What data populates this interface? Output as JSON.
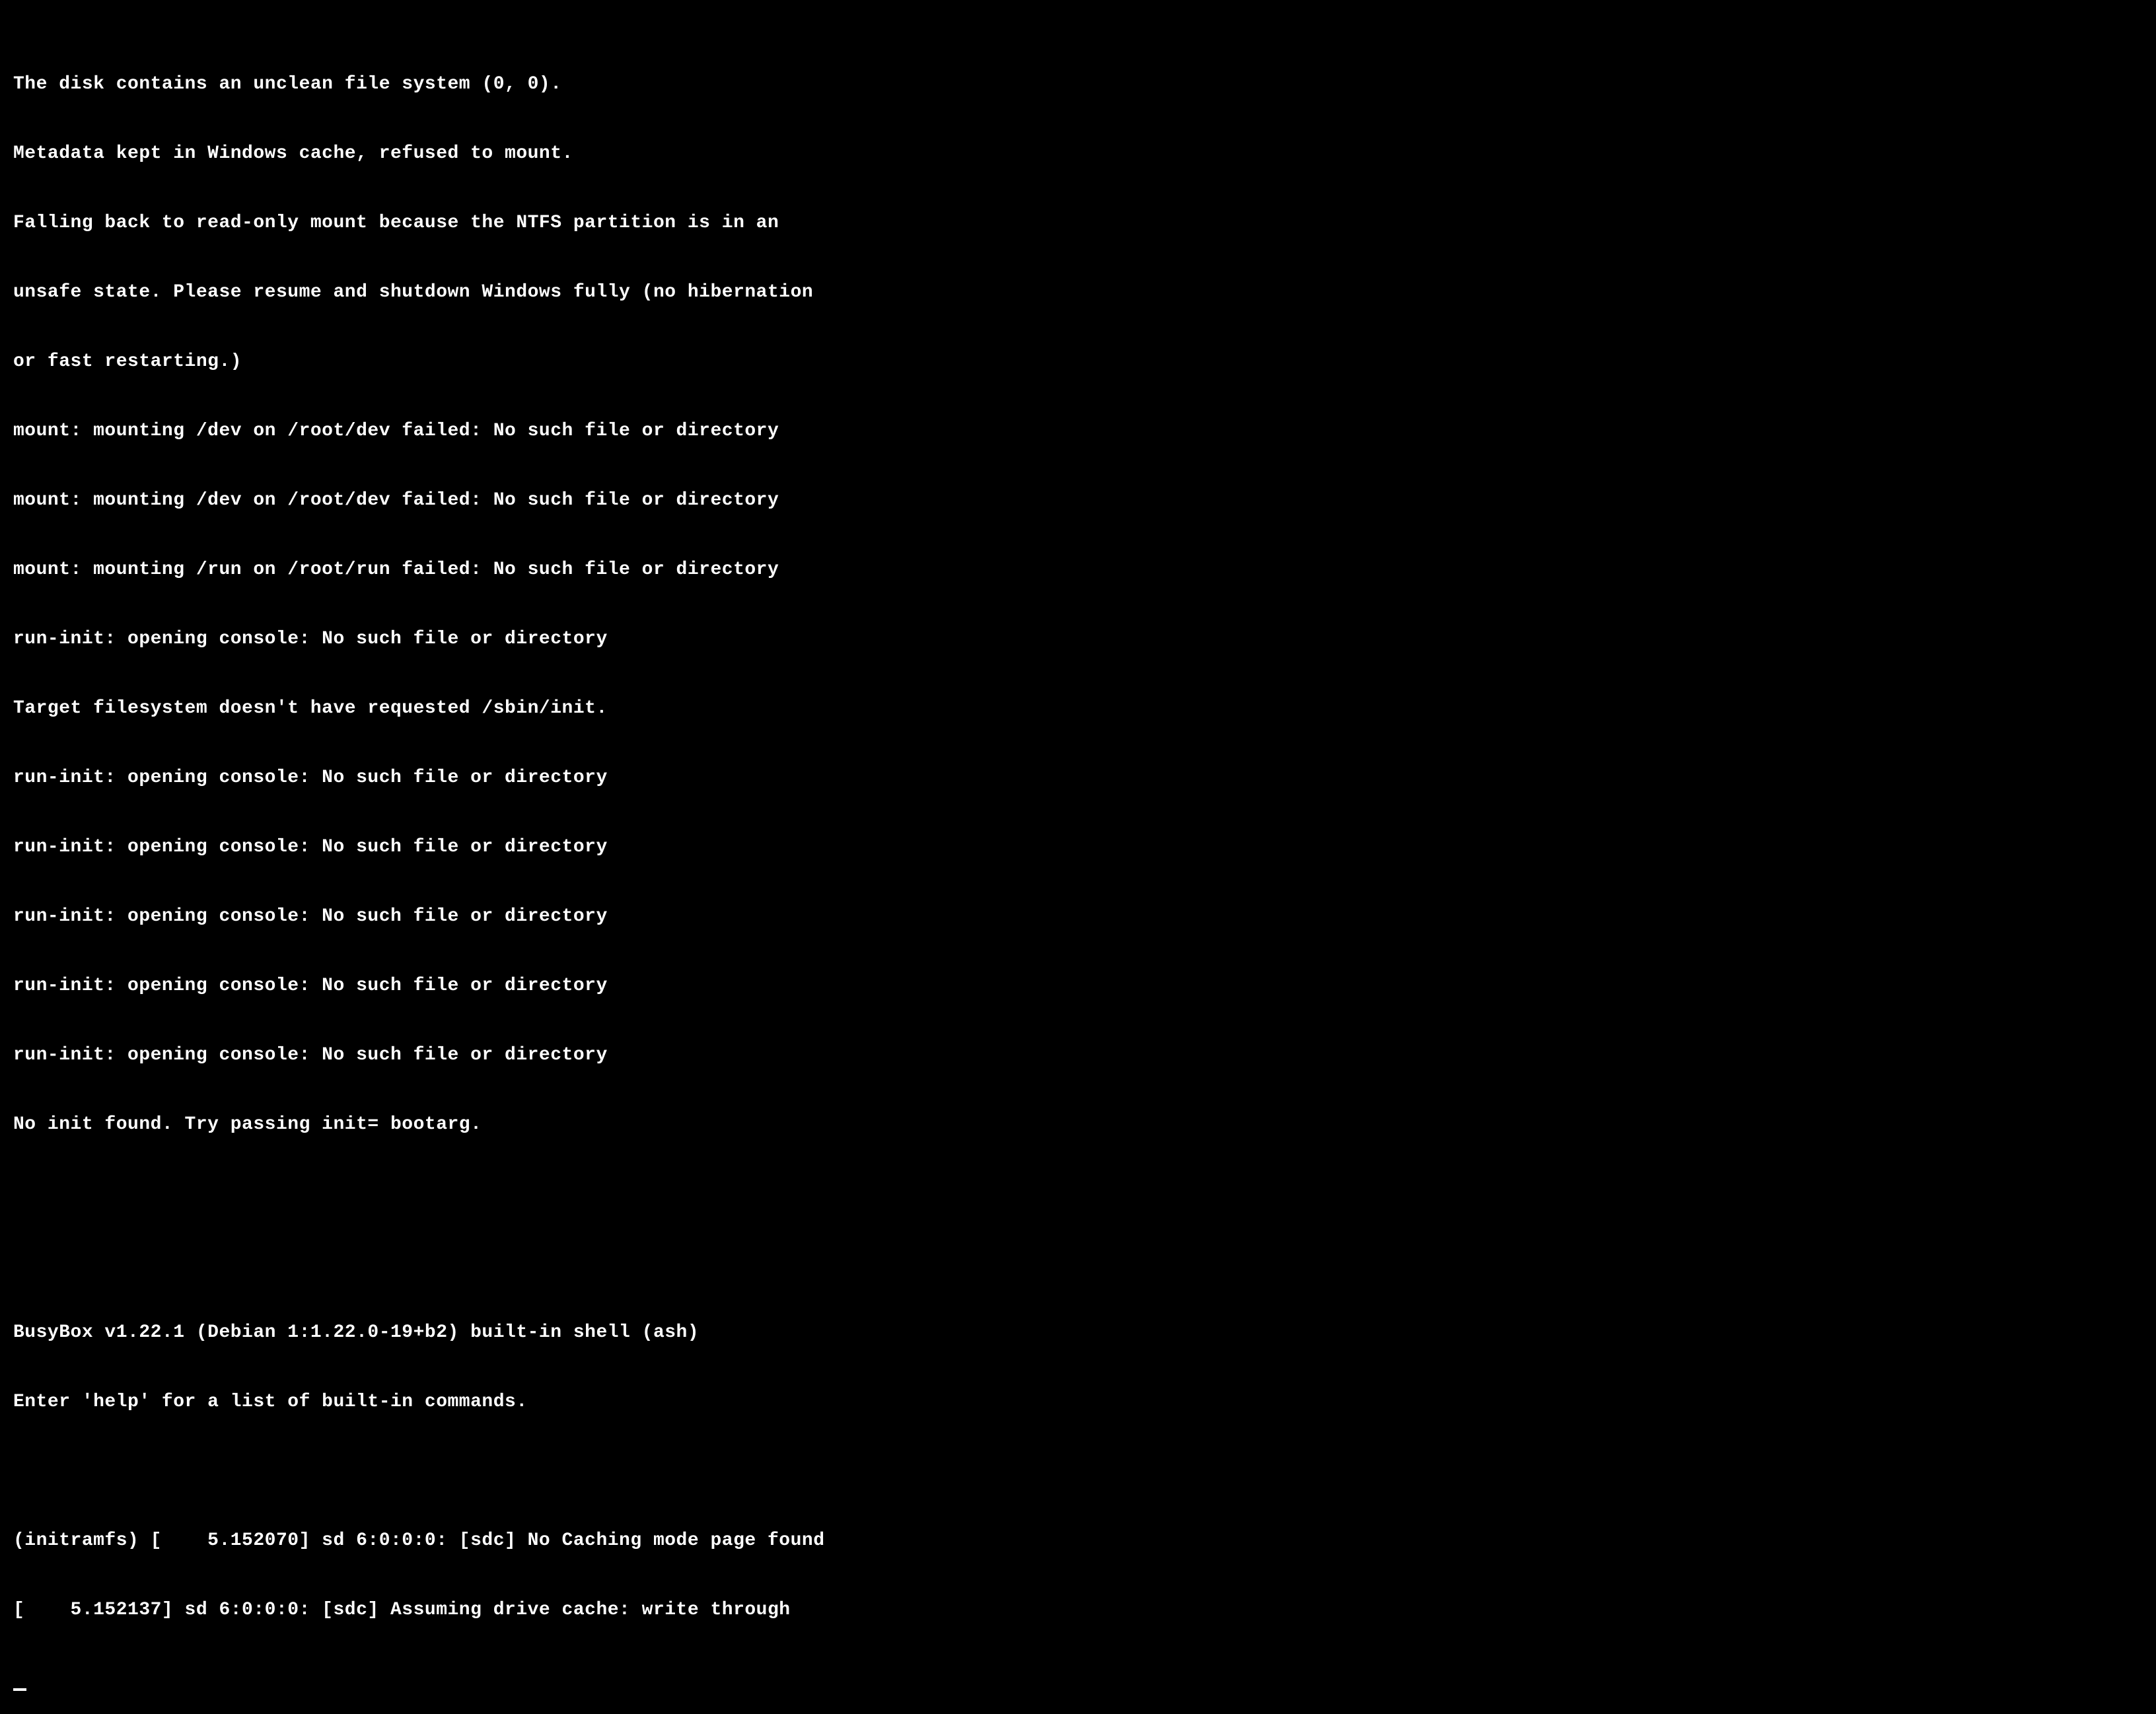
{
  "terminal": {
    "lines": [
      "The disk contains an unclean file system (0, 0).",
      "Metadata kept in Windows cache, refused to mount.",
      "Falling back to read-only mount because the NTFS partition is in an",
      "unsafe state. Please resume and shutdown Windows fully (no hibernation",
      "or fast restarting.)",
      "mount: mounting /dev on /root/dev failed: No such file or directory",
      "mount: mounting /dev on /root/dev failed: No such file or directory",
      "mount: mounting /run on /root/run failed: No such file or directory",
      "run-init: opening console: No such file or directory",
      "Target filesystem doesn't have requested /sbin/init.",
      "run-init: opening console: No such file or directory",
      "run-init: opening console: No such file or directory",
      "run-init: opening console: No such file or directory",
      "run-init: opening console: No such file or directory",
      "run-init: opening console: No such file or directory",
      "No init found. Try passing init= bootarg.",
      "",
      "",
      "BusyBox v1.22.1 (Debian 1:1.22.0-19+b2) built-in shell (ash)",
      "Enter 'help' for a list of built-in commands.",
      "",
      "(initramfs) [    5.152070] sd 6:0:0:0: [sdc] No Caching mode page found",
      "[    5.152137] sd 6:0:0:0: [sdc] Assuming drive cache: write through"
    ]
  }
}
